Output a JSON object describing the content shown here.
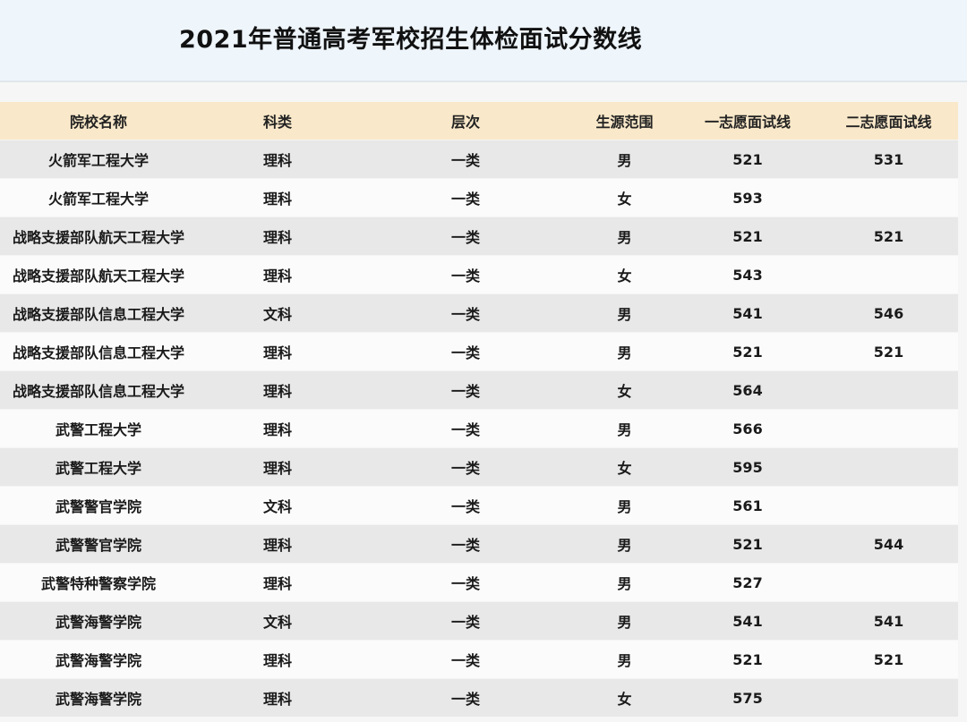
{
  "page": {
    "title": "2021年普通高考军校招生体检面试分数线"
  },
  "table": {
    "headers": [
      "院校名称",
      "科类",
      "层次",
      "生源范围",
      "一志愿面试线",
      "二志愿面试线"
    ],
    "rows": [
      [
        "火箭军工程大学",
        "理科",
        "一类",
        "男",
        "521",
        "531"
      ],
      [
        "火箭军工程大学",
        "理科",
        "一类",
        "女",
        "593",
        ""
      ],
      [
        "战略支援部队航天工程大学",
        "理科",
        "一类",
        "男",
        "521",
        "521"
      ],
      [
        "战略支援部队航天工程大学",
        "理科",
        "一类",
        "女",
        "543",
        ""
      ],
      [
        "战略支援部队信息工程大学",
        "文科",
        "一类",
        "男",
        "541",
        "546"
      ],
      [
        "战略支援部队信息工程大学",
        "理科",
        "一类",
        "男",
        "521",
        "521"
      ],
      [
        "战略支援部队信息工程大学",
        "理科",
        "一类",
        "女",
        "564",
        ""
      ],
      [
        "武警工程大学",
        "理科",
        "一类",
        "男",
        "566",
        ""
      ],
      [
        "武警工程大学",
        "理科",
        "一类",
        "女",
        "595",
        ""
      ],
      [
        "武警警官学院",
        "文科",
        "一类",
        "男",
        "561",
        ""
      ],
      [
        "武警警官学院",
        "理科",
        "一类",
        "男",
        "521",
        "544"
      ],
      [
        "武警特种警察学院",
        "理科",
        "一类",
        "男",
        "527",
        ""
      ],
      [
        "武警海警学院",
        "文科",
        "一类",
        "男",
        "541",
        "541"
      ],
      [
        "武警海警学院",
        "理科",
        "一类",
        "男",
        "521",
        "521"
      ],
      [
        "武警海警学院",
        "理科",
        "一类",
        "女",
        "575",
        ""
      ]
    ]
  }
}
